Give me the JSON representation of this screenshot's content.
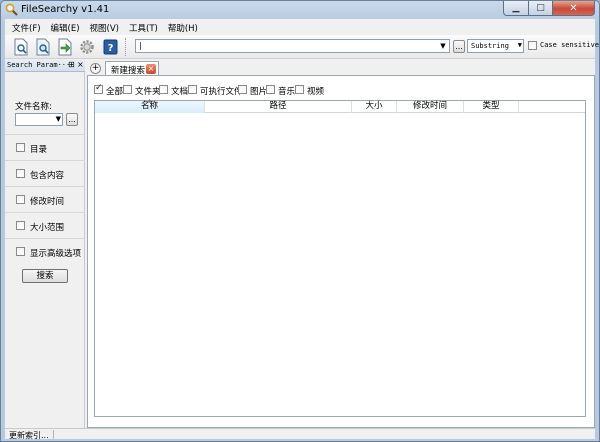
{
  "window": {
    "title": "FileSearchy v1.41"
  },
  "menu": [
    "文件(F)",
    "编辑(E)",
    "视图(V)",
    "工具(T)",
    "帮助(H)"
  ],
  "toolbar": {
    "path_value": "|",
    "browse_label": "...",
    "mode_value": "Substring",
    "case_label": "Case sensitive"
  },
  "left_panel": {
    "title": "Search Param···",
    "filename_label": "文件名称:",
    "browse_label": "...",
    "options": [
      "目录",
      "包含内容",
      "修改时间",
      "大小范围",
      "显示高级选项"
    ],
    "search_button": "搜索"
  },
  "tab": {
    "label": "新建搜索"
  },
  "filters": [
    {
      "label": "全部",
      "checked": true
    },
    {
      "label": "文件夹",
      "checked": false
    },
    {
      "label": "文档",
      "checked": false
    },
    {
      "label": "可执行文件",
      "checked": false
    },
    {
      "label": "图片",
      "checked": false
    },
    {
      "label": "音乐",
      "checked": false
    },
    {
      "label": "视频",
      "checked": false
    }
  ],
  "columns": [
    "名称",
    "路径",
    "大小",
    "修改时间",
    "类型"
  ],
  "status": {
    "text": "更新索引..."
  },
  "colors": {
    "title_bar": "#c9d9ec",
    "close_button": "#c8483a",
    "active_column": "#d9eefa"
  }
}
